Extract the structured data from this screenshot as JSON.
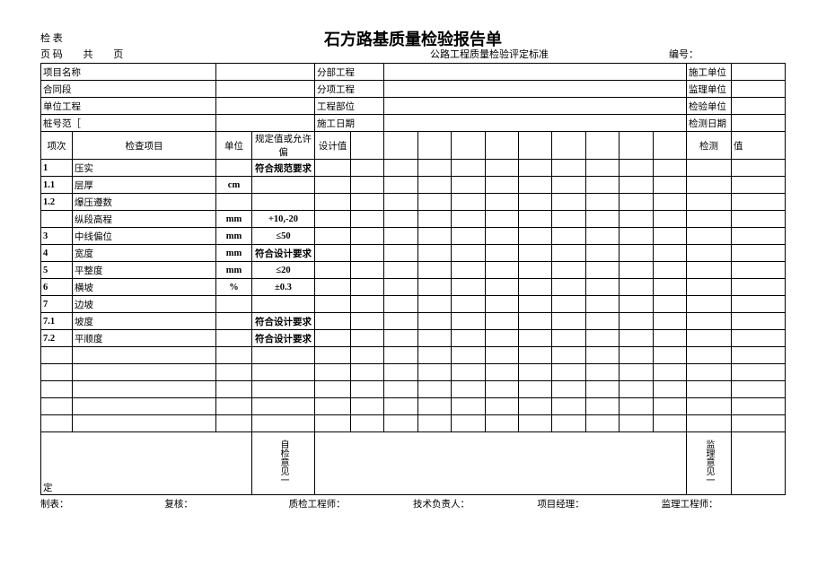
{
  "header": {
    "check_label": "检 表",
    "title": "石方路基质量检验报告单",
    "page_prefix": "页 码",
    "page_gong": "共",
    "page_ye": "页",
    "standard": "公路工程质量检验评定标准",
    "code_label": "编号："
  },
  "meta": {
    "r1c1": "项目名称",
    "r1c2": "分部工程",
    "r1c3": "施工单位",
    "r2c1": "合同段",
    "r2c2": "分项工程",
    "r2c3": "监理单位",
    "r3c1": "单位工程",
    "r3c2": "工程部位",
    "r3c3": "检验单位",
    "r4c1": "桩号范［",
    "r4c2": "施工日期",
    "r4c3": "检测日期"
  },
  "cols": {
    "idx": "项次",
    "item": "检查项目",
    "unit": "单位",
    "spec": "规定值或允许偏",
    "design": "设计值",
    "measure": "检测",
    "val": "值"
  },
  "rows": [
    {
      "idx": "1",
      "item": "压实",
      "unit": "",
      "spec": "符合规范要求"
    },
    {
      "idx": "1.1",
      "item": "层厚",
      "unit": "cm",
      "spec": ""
    },
    {
      "idx": "1.2",
      "item": "爆压遵数",
      "unit": "",
      "spec": ""
    },
    {
      "idx": "",
      "item": "纵段高程",
      "unit": "mm",
      "spec": "+10,-20"
    },
    {
      "idx": "3",
      "item": "中线偏位",
      "unit": "mm",
      "spec": "≤50"
    },
    {
      "idx": "4",
      "item": "宽度",
      "unit": "mm",
      "spec": "符合设计要求"
    },
    {
      "idx": "5",
      "item": "平整度",
      "unit": "mm",
      "spec": "≤20"
    },
    {
      "idx": "6",
      "item": "横坡",
      "unit": "%",
      "spec": "±0.3"
    },
    {
      "idx": "7",
      "item": "边坡",
      "unit": "",
      "spec": ""
    },
    {
      "idx": "7.1",
      "item": "坡度",
      "unit": "",
      "spec": "符合设计要求"
    },
    {
      "idx": "7.2",
      "item": "平顺度",
      "unit": "",
      "spec": "符合设计要求"
    }
  ],
  "opinions": {
    "self": "自检意见一",
    "supervise": "监理意见一",
    "ding": "定"
  },
  "footer": {
    "a": "制表：",
    "b": "复核：",
    "c": "质检工程师：",
    "d": "技术负责人：",
    "e": "项目经理：",
    "f": "监理工程师："
  }
}
